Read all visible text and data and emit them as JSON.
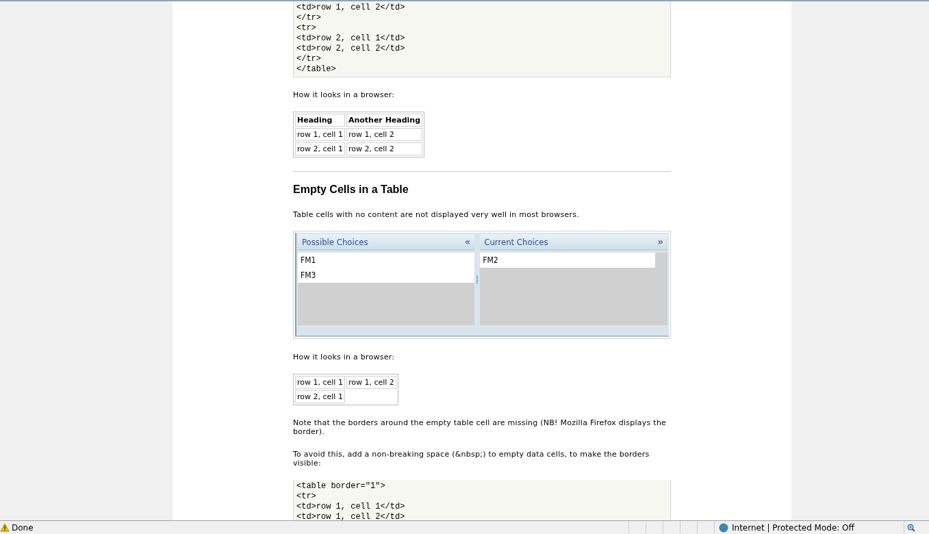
{
  "content": [
    {
      "kind": "code",
      "lines": [
        "<td>row 1, cell 2</td>",
        "</tr>",
        "<tr>",
        "<td>row 2, cell 1</td>",
        "<td>row 2, cell 2</td>",
        "</tr>",
        "</table>"
      ]
    },
    {
      "kind": "paragraph",
      "text": "How it looks in a browser:"
    },
    {
      "kind": "table",
      "rows": [
        [
          {
            "text": "Heading",
            "header": true
          },
          {
            "text": "Another Heading",
            "header": true
          }
        ],
        [
          {
            "text": "row 1, cell 1",
            "header": false
          },
          {
            "text": "row 1, cell 2",
            "header": false
          }
        ],
        [
          {
            "text": "row 2, cell 1",
            "header": false
          },
          {
            "text": "row 2, cell 2",
            "header": false
          }
        ]
      ]
    },
    {
      "kind": "rule"
    },
    {
      "kind": "heading",
      "text": "Empty Cells in a Table"
    },
    {
      "kind": "paragraph",
      "text": "Table cells with no content are not displayed very well in most browsers."
    },
    {
      "kind": "chooser",
      "panels": [
        {
          "title": "Possible Choices",
          "arrow": "«",
          "items": [
            "FM1",
            "FM3"
          ]
        },
        {
          "title": "Current Choices",
          "arrow": "»",
          "items": [
            "FM2"
          ]
        }
      ]
    },
    {
      "kind": "paragraph",
      "text": "How it looks in a browser:"
    },
    {
      "kind": "table",
      "rows": [
        [
          {
            "text": "row 1, cell 1",
            "header": false
          },
          {
            "text": "row 1, cell 2",
            "header": false
          }
        ],
        [
          {
            "text": "row 2, cell 1",
            "header": false
          }
        ]
      ]
    },
    {
      "kind": "paragraph",
      "text": "Note that the borders around the empty table cell are missing (NB! Mozilla Firefox displays the border)."
    },
    {
      "kind": "paragraph",
      "text": "To avoid this, add a non-breaking space (&nbsp;) to empty data cells, to make the borders visible:"
    },
    {
      "kind": "code",
      "lines": [
        "<table border=\"1\">",
        "<tr>",
        "<td>row 1, cell 1</td>",
        "<td>row 1, cell 2</td>"
      ]
    }
  ],
  "status_bar": {
    "text": "Done",
    "zone": "Internet | Protected Mode: Off"
  }
}
